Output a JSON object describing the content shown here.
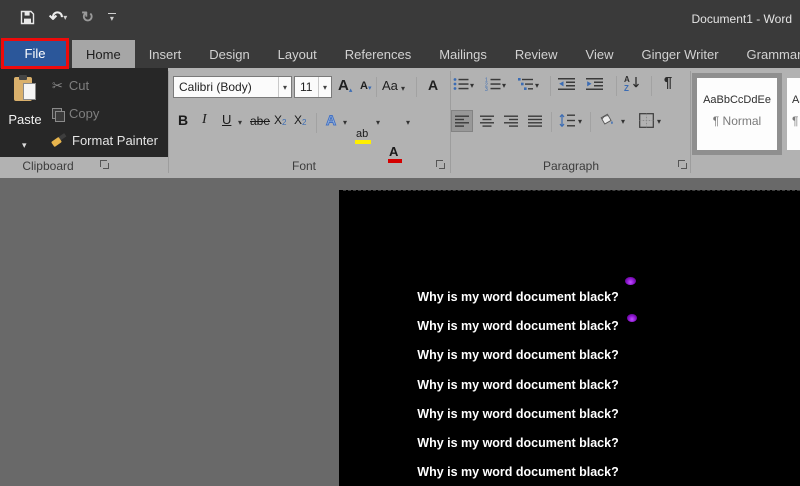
{
  "titlebar": {
    "title": "Document1 - Word",
    "icons": [
      "save-icon",
      "undo-icon",
      "redo-icon",
      "customize-quick-access-icon"
    ]
  },
  "tabs": {
    "file": "File",
    "active": "Home",
    "items": [
      "Home",
      "Insert",
      "Design",
      "Layout",
      "References",
      "Mailings",
      "Review",
      "View",
      "Ginger Writer",
      "Grammarly"
    ]
  },
  "ribbon": {
    "clipboard": {
      "label": "Clipboard",
      "paste": "Paste",
      "cut": "Cut",
      "copy": "Copy",
      "format_painter": "Format Painter"
    },
    "font": {
      "label": "Font",
      "font_name": "Calibri (Body)",
      "font_size": "11",
      "grow": "A",
      "shrink": "A",
      "change_case": "Aa",
      "clear_formatting": "A",
      "bold": "B",
      "italic": "I",
      "underline": "U",
      "strikethrough": "abe",
      "sub_base": "X",
      "sub_digit": "2",
      "sup_base": "X",
      "sup_digit": "2",
      "text_effects": "A",
      "highlight": "ab",
      "font_color": "A"
    },
    "paragraph": {
      "label": "Paragraph",
      "show_hide_mark": "¶"
    },
    "styles": {
      "normal_sample": "AaBbCcDdEe",
      "normal_name": "¶ Normal",
      "second_sample": "Aa",
      "second_name": "¶ N"
    }
  },
  "document": {
    "lines": [
      "Why is my word document black?",
      "Why is my word document black?",
      "Why is my word document black?",
      "Why is my word document black?",
      "Why is my word document black?",
      "Why is my word document black?",
      "Why is my word document black?"
    ]
  },
  "colors": {
    "titlebar_bg": "#3a3a3a",
    "file_tab_blue": "#2b579a",
    "annotation_red": "#ee0a0a",
    "ribbon_bg": "#b2b2b2",
    "glitch_block": "#272727",
    "doc_background": "#696969",
    "page_black": "#000000",
    "highlight_yellow": "#ffef00",
    "font_color_red": "#d40000",
    "ink_dot_purple": "#8912cc",
    "accent_blue": "#3b6cb4"
  }
}
